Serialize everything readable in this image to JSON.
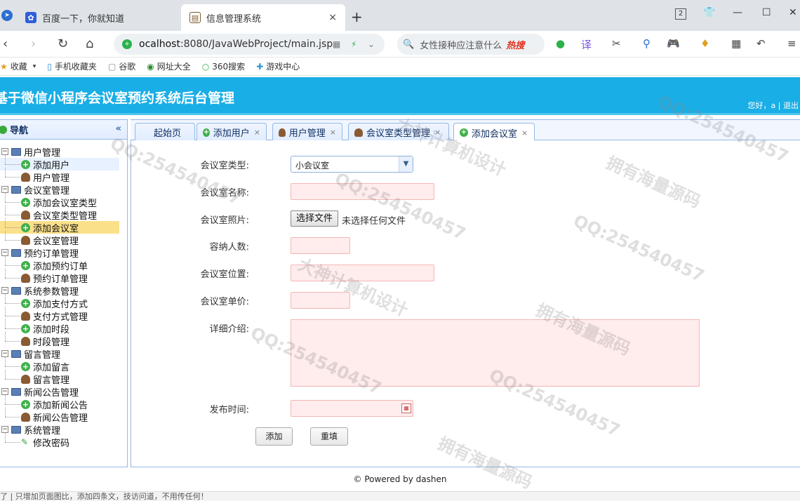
{
  "browser": {
    "tabs": [
      {
        "label": "百度一下，你就知道",
        "close": ""
      },
      {
        "label": "信息管理系统",
        "close": "×"
      }
    ],
    "new_tab": "+",
    "tab_count": "2",
    "url_prefix": "ocalhost",
    "url_rest": ":8080/JavaWebProject/main.jsp",
    "search_text": "女性接种应注意什么",
    "search_hot": "热搜"
  },
  "bookmarks": [
    {
      "icon": "star-icon",
      "label": "收藏"
    },
    {
      "icon": "phone-icon",
      "label": "手机收藏夹"
    },
    {
      "icon": "page-icon",
      "label": "谷歌"
    },
    {
      "icon": "globe-icon",
      "label": "网址大全"
    },
    {
      "icon": "search-icon",
      "label": "360搜索"
    },
    {
      "icon": "game-icon",
      "label": "游戏中心"
    }
  ],
  "app": {
    "title": "基于微信小程序会议室预约系统后台管理",
    "user_greeting": "您好，a | 退出"
  },
  "sidebar": {
    "title": "导航",
    "collapse": "«",
    "groups": [
      {
        "label": "用户管理",
        "items": [
          {
            "label": "添加用户",
            "type": "add"
          },
          {
            "label": "用户管理",
            "type": "user"
          }
        ]
      },
      {
        "label": "会议室管理",
        "items": [
          {
            "label": "添加会议室类型",
            "type": "add"
          },
          {
            "label": "会议室类型管理",
            "type": "user"
          },
          {
            "label": "添加会议室",
            "type": "add"
          },
          {
            "label": "会议室管理",
            "type": "user"
          }
        ]
      },
      {
        "label": "预约订单管理",
        "items": [
          {
            "label": "添加预约订单",
            "type": "add"
          },
          {
            "label": "预约订单管理",
            "type": "user"
          }
        ]
      },
      {
        "label": "系统参数管理",
        "items": [
          {
            "label": "添加支付方式",
            "type": "add"
          },
          {
            "label": "支付方式管理",
            "type": "user"
          },
          {
            "label": "添加时段",
            "type": "add"
          },
          {
            "label": "时段管理",
            "type": "user"
          }
        ]
      },
      {
        "label": "留言管理",
        "items": [
          {
            "label": "添加留言",
            "type": "add"
          },
          {
            "label": "留言管理",
            "type": "user"
          }
        ]
      },
      {
        "label": "新闻公告管理",
        "items": [
          {
            "label": "添加新闻公告",
            "type": "add"
          },
          {
            "label": "新闻公告管理",
            "type": "user"
          }
        ]
      },
      {
        "label": "系统管理",
        "items": [
          {
            "label": "修改密码",
            "type": "pen"
          }
        ]
      }
    ]
  },
  "main_tabs": [
    {
      "label": "起始页"
    },
    {
      "label": "添加用户"
    },
    {
      "label": "用户管理"
    },
    {
      "label": "会议室类型管理"
    },
    {
      "label": "添加会议室"
    }
  ],
  "tab_close": "×",
  "form": {
    "type_label": "会议室类型:",
    "type_value": "小会议室",
    "name_label": "会议室名称:",
    "photo_label": "会议室照片:",
    "file_button": "选择文件",
    "file_status": "未选择任何文件",
    "capacity_label": "容纳人数:",
    "location_label": "会议室位置:",
    "price_label": "会议室单价:",
    "desc_label": "详细介绍:",
    "time_label": "发布时间:",
    "submit": "添加",
    "reset": "重填"
  },
  "footer": "© Powered by dashen",
  "status_bar": "了 | 只增加页面图比，添加四条文，技访问道，不用传任何！",
  "watermarks": [
    "QQ:254540457",
    "大神计算机设计",
    "拥有海量源码"
  ]
}
